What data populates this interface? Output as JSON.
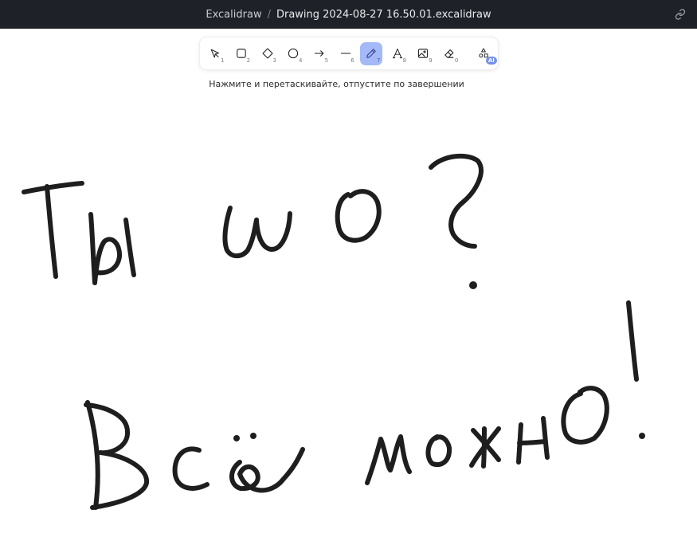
{
  "titlebar": {
    "app_name": "Excalidraw",
    "separator": "/",
    "file_name": "Drawing 2024-08-27 16.50.01.excalidraw"
  },
  "toolbar": {
    "tools": [
      {
        "name": "selection",
        "icon": "pointer-icon",
        "key": "1"
      },
      {
        "name": "rectangle",
        "icon": "square-icon",
        "key": "2"
      },
      {
        "name": "diamond",
        "icon": "diamond-icon",
        "key": "3"
      },
      {
        "name": "ellipse",
        "icon": "circle-icon",
        "key": "4"
      },
      {
        "name": "arrow",
        "icon": "arrow-right-icon",
        "key": "5"
      },
      {
        "name": "line",
        "icon": "line-icon",
        "key": "6"
      },
      {
        "name": "draw",
        "icon": "pencil-icon",
        "key": "7",
        "active": true
      },
      {
        "name": "text",
        "icon": "text-icon",
        "key": "8"
      },
      {
        "name": "image",
        "icon": "image-icon",
        "key": "9"
      },
      {
        "name": "eraser",
        "icon": "eraser-icon",
        "key": "0"
      },
      {
        "name": "more-tools",
        "icon": "shapes-icon",
        "badge": "AI"
      }
    ],
    "active_color": "#a5b9f8"
  },
  "hint": "Нажмите и перетаскивайте, отпустите по завершении",
  "canvas": {
    "stroke_color": "#1e1e1e",
    "background": "#ffffff"
  }
}
